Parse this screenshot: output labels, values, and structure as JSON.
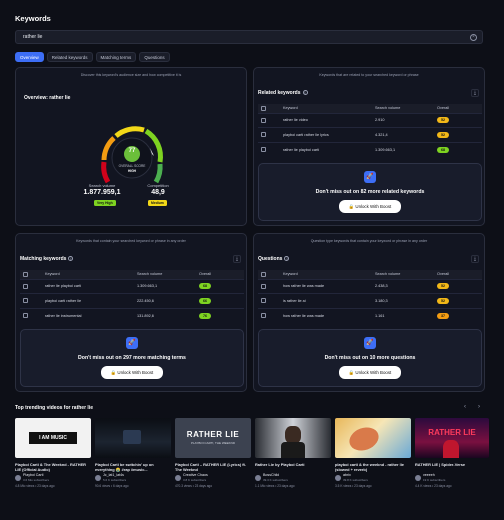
{
  "header": {
    "title": "Keywords"
  },
  "search": {
    "value": "rather lie"
  },
  "tabs": [
    "Overview",
    "Related keywords",
    "Matching terms",
    "Questions"
  ],
  "overview": {
    "note": "Discover this keyword's audience size and how competitive it is",
    "title": "Overview: rather lie",
    "score": "77",
    "score_label": "OVERALL SCORE",
    "score_rating": "HIGH",
    "volume_label": "Search volume",
    "volume_value": "1.877.959,1",
    "volume_badge": "Very High",
    "competition_label": "Competition",
    "competition_value": "48,9",
    "competition_badge": "Medium"
  },
  "related": {
    "note": "Keywords that are related to your searched keyword or phrase",
    "title": "Related keywords",
    "columns": [
      "Keyword",
      "Search volume",
      "Overall"
    ],
    "rows": [
      {
        "keyword": "rather lie video",
        "volume": "2.910",
        "overall": "52",
        "color": "#f2b818"
      },
      {
        "keyword": "playboi carti rather lie lyrics",
        "volume": "4.321,4",
        "overall": "52",
        "color": "#f2b818"
      },
      {
        "keyword": "rather lie playboi carti",
        "volume": "1.309.663,1",
        "overall": "68",
        "color": "#7ed321"
      }
    ],
    "upsell_text": "Don't miss out on 82 more related keywords",
    "upsell_button": "Unlock With Boost"
  },
  "matching": {
    "note": "Keywords that contain your searched keyword or phrase in any order",
    "title": "Matching keywords",
    "columns": [
      "Keyword",
      "Search volume",
      "Overall"
    ],
    "rows": [
      {
        "keyword": "rather lie playboi carti",
        "volume": "1.309.663,1",
        "overall": "68",
        "color": "#7ed321"
      },
      {
        "keyword": "playboi carti rather lie",
        "volume": "222.450,6",
        "overall": "66",
        "color": "#7ed321"
      },
      {
        "keyword": "rather lie instrumental",
        "volume": "131.892,6",
        "overall": "76",
        "color": "#7ed321"
      }
    ],
    "upsell_text": "Don't miss out on 297 more matching terms",
    "upsell_button": "Unlock With Boost"
  },
  "questions": {
    "note": "Question type keywords that contain your keyword or phrase in any order",
    "title": "Questions",
    "columns": [
      "Keyword",
      "Search volume",
      "Overall"
    ],
    "rows": [
      {
        "keyword": "how rather lie was made",
        "volume": "2.438,3",
        "overall": "52",
        "color": "#f2b818"
      },
      {
        "keyword": "is rather lie ai",
        "volume": "3.180,3",
        "overall": "52",
        "color": "#f2b818"
      },
      {
        "keyword": "how rather lie was made",
        "volume": "1.161",
        "overall": "37",
        "color": "#f39c12"
      }
    ],
    "upsell_text": "Don't miss out on 10 more questions",
    "upsell_button": "Unlock With Boost"
  },
  "videos_section": {
    "title": "Top trending videos for rather lie",
    "prev": "‹",
    "next": "›"
  },
  "videos": [
    {
      "title": "Playboi Carti & The Weeknd - RATHER LIE (Official Audio)",
      "channel": "Playboi Carti",
      "subs": "3.6 Mio subscribers",
      "stats": "4.8 Mio views • 23 days ago",
      "thumb_text": "I AM MUSIC"
    },
    {
      "title": "Playboi Carti be switchin' up on everything 😭 #rap #music...",
      "channel": "Jc_lat1_lat4s",
      "subs": "5.6 K subscribers",
      "stats": "90.6 views • 6 days ago",
      "thumb_text": ""
    },
    {
      "title": "Playboi Carti – RATHER LIE (Lyrics) ft. The Weeknd",
      "channel": "Creative Chaos",
      "subs": "3.8 K subscribers",
      "stats": "470.3 views • 23 days ago",
      "thumb_text": "RATHER LIE",
      "thumb_sub": "PLAYBOI CARTI, THE WEEKND"
    },
    {
      "title": "Rather Lie by Playboi Carti",
      "channel": "BossChild",
      "subs": "39.3 K subscribers",
      "stats": "1.1 Mio views • 23 days ago",
      "thumb_text": ""
    },
    {
      "title": "playboi carti & the weeknd - rather lie (slowed + reverb)",
      "channel": "abrix",
      "subs": "39.8 K subscribers",
      "stats": "3.5 K views • 23 days ago",
      "thumb_text": ""
    },
    {
      "title": "RATHER LIE | Spider-Verse",
      "channel": "veeeeh",
      "subs": "19 K subscribers",
      "stats": "4.4 K views • 23 days ago",
      "thumb_text": "RATHER LIE"
    }
  ]
}
